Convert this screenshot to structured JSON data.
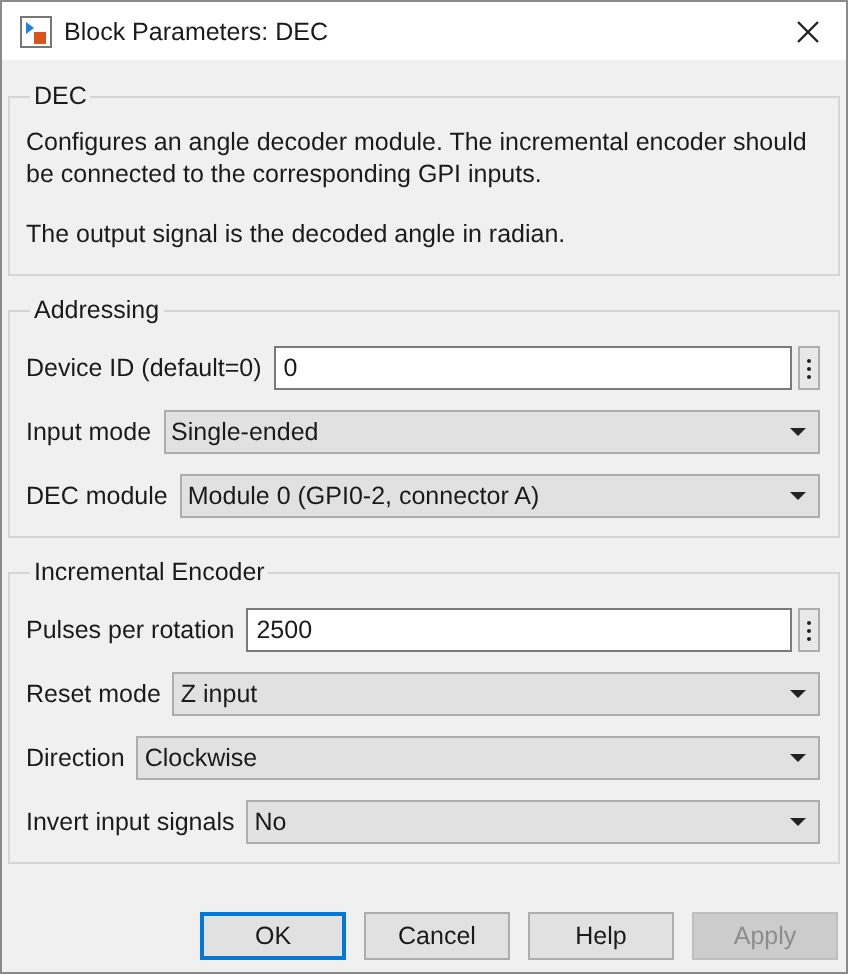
{
  "window": {
    "title": "Block Parameters: DEC"
  },
  "groups": [
    {
      "title": "DEC",
      "paragraphs": [
        "Configures an angle decoder module. The incremental encoder should be connected to the corresponding GPI inputs.",
        "The output signal is the decoded angle in radian."
      ]
    },
    {
      "title": "Addressing",
      "params": [
        {
          "kind": "edit",
          "label": "Device ID (default=0)",
          "value": "0"
        },
        {
          "kind": "popup",
          "label": "Input mode",
          "value": "Single-ended"
        },
        {
          "kind": "popup",
          "label": "DEC module",
          "value": "Module 0 (GPI0-2, connector A)"
        }
      ]
    },
    {
      "title": "Incremental Encoder",
      "params": [
        {
          "kind": "edit",
          "label": "Pulses per rotation",
          "value": "2500"
        },
        {
          "kind": "popup",
          "label": "Reset mode",
          "value": "Z input"
        },
        {
          "kind": "popup",
          "label": "Direction",
          "value": "Clockwise"
        },
        {
          "kind": "popup",
          "label": "Invert input signals",
          "value": "No"
        }
      ]
    }
  ],
  "buttons": [
    {
      "label": "OK",
      "default": true,
      "disabled": false
    },
    {
      "label": "Cancel",
      "default": false,
      "disabled": false
    },
    {
      "label": "Help",
      "default": false,
      "disabled": false
    },
    {
      "label": "Apply",
      "default": false,
      "disabled": true
    }
  ]
}
